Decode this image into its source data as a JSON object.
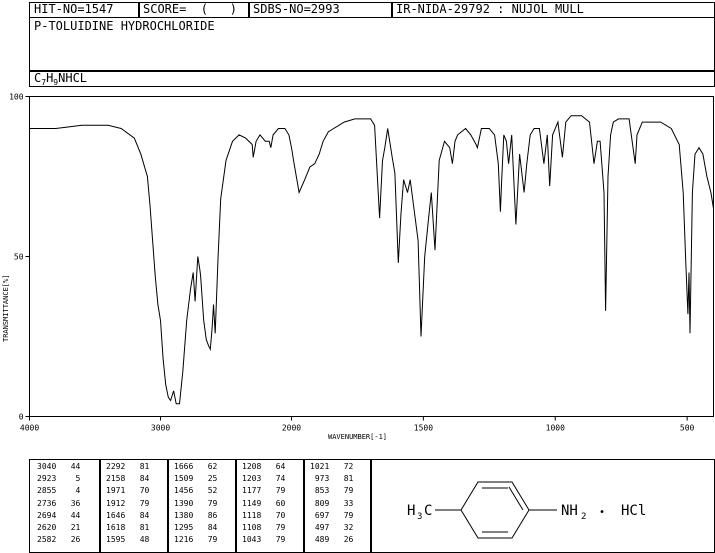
{
  "header": {
    "hit_no": "HIT-NO=1547",
    "score": "SCORE=  (   )",
    "sdbs_no": "SDBS-NO=2993",
    "ir_nida": "IR-NIDA-29792 : NUJOL MULL"
  },
  "compound": {
    "name": "P-TOLUIDINE HYDROCHLORIDE",
    "formula": {
      "c": "C",
      "c_sub": "7",
      "h": "H",
      "h_sub": "9",
      "rest": "NHCL"
    }
  },
  "structure": {
    "left_label": "H",
    "left_sub": "3",
    "left_c": "C",
    "right_label": "NH",
    "right_sub": "2",
    "dot": "•",
    "hcl": "HCl"
  },
  "chart_data": {
    "type": "line",
    "xlabel": "WAVENUMBER[-1]",
    "ylabel": "TRANSMITTANCE[%]",
    "xlim": [
      4000,
      400
    ],
    "ylim": [
      0,
      100
    ],
    "x_ticks": [
      "4000",
      "3000",
      "2000",
      "1500",
      "1000",
      "500"
    ],
    "y_ticks": [
      "100",
      "50",
      "0"
    ],
    "grid": false,
    "series": [
      {
        "points": [
          [
            4000,
            90
          ],
          [
            3800,
            90
          ],
          [
            3600,
            91
          ],
          [
            3400,
            91
          ],
          [
            3300,
            90
          ],
          [
            3200,
            87
          ],
          [
            3150,
            82
          ],
          [
            3100,
            75
          ],
          [
            3080,
            66
          ],
          [
            3060,
            55
          ],
          [
            3040,
            44
          ],
          [
            3020,
            35
          ],
          [
            3000,
            30
          ],
          [
            2980,
            18
          ],
          [
            2960,
            10
          ],
          [
            2940,
            6
          ],
          [
            2923,
            5
          ],
          [
            2900,
            8
          ],
          [
            2880,
            4
          ],
          [
            2855,
            4
          ],
          [
            2830,
            14
          ],
          [
            2800,
            30
          ],
          [
            2770,
            40
          ],
          [
            2750,
            45
          ],
          [
            2736,
            36
          ],
          [
            2715,
            50
          ],
          [
            2700,
            46
          ],
          [
            2694,
            44
          ],
          [
            2670,
            30
          ],
          [
            2650,
            24
          ],
          [
            2632,
            22
          ],
          [
            2620,
            21
          ],
          [
            2605,
            28
          ],
          [
            2595,
            35
          ],
          [
            2582,
            26
          ],
          [
            2560,
            50
          ],
          [
            2540,
            68
          ],
          [
            2500,
            80
          ],
          [
            2450,
            86
          ],
          [
            2400,
            88
          ],
          [
            2350,
            87
          ],
          [
            2300,
            85
          ],
          [
            2292,
            81
          ],
          [
            2270,
            86
          ],
          [
            2240,
            88
          ],
          [
            2200,
            86
          ],
          [
            2170,
            86
          ],
          [
            2158,
            84
          ],
          [
            2140,
            88
          ],
          [
            2100,
            90
          ],
          [
            2050,
            90
          ],
          [
            2020,
            88
          ],
          [
            2000,
            84
          ],
          [
            1990,
            79
          ],
          [
            1971,
            70
          ],
          [
            1950,
            74
          ],
          [
            1930,
            78
          ],
          [
            1912,
            79
          ],
          [
            1895,
            82
          ],
          [
            1880,
            86
          ],
          [
            1860,
            89
          ],
          [
            1840,
            90
          ],
          [
            1800,
            92
          ],
          [
            1760,
            93
          ],
          [
            1720,
            93
          ],
          [
            1700,
            93
          ],
          [
            1685,
            91
          ],
          [
            1666,
            62
          ],
          [
            1655,
            80
          ],
          [
            1646,
            84
          ],
          [
            1635,
            90
          ],
          [
            1618,
            81
          ],
          [
            1608,
            76
          ],
          [
            1595,
            48
          ],
          [
            1585,
            63
          ],
          [
            1575,
            74
          ],
          [
            1560,
            70
          ],
          [
            1550,
            74
          ],
          [
            1520,
            55
          ],
          [
            1509,
            25
          ],
          [
            1495,
            50
          ],
          [
            1480,
            62
          ],
          [
            1470,
            70
          ],
          [
            1456,
            52
          ],
          [
            1440,
            80
          ],
          [
            1420,
            86
          ],
          [
            1400,
            84
          ],
          [
            1390,
            79
          ],
          [
            1380,
            86
          ],
          [
            1370,
            88
          ],
          [
            1340,
            90
          ],
          [
            1320,
            88
          ],
          [
            1300,
            85
          ],
          [
            1295,
            84
          ],
          [
            1280,
            90
          ],
          [
            1250,
            90
          ],
          [
            1230,
            88
          ],
          [
            1216,
            79
          ],
          [
            1208,
            64
          ],
          [
            1203,
            74
          ],
          [
            1195,
            88
          ],
          [
            1185,
            86
          ],
          [
            1177,
            79
          ],
          [
            1165,
            88
          ],
          [
            1149,
            60
          ],
          [
            1135,
            82
          ],
          [
            1118,
            70
          ],
          [
            1108,
            79
          ],
          [
            1095,
            88
          ],
          [
            1080,
            90
          ],
          [
            1060,
            90
          ],
          [
            1043,
            79
          ],
          [
            1030,
            88
          ],
          [
            1021,
            72
          ],
          [
            1010,
            88
          ],
          [
            990,
            92
          ],
          [
            973,
            81
          ],
          [
            960,
            92
          ],
          [
            940,
            94
          ],
          [
            900,
            94
          ],
          [
            870,
            92
          ],
          [
            853,
            79
          ],
          [
            840,
            86
          ],
          [
            830,
            86
          ],
          [
            815,
            70
          ],
          [
            809,
            33
          ],
          [
            800,
            75
          ],
          [
            790,
            88
          ],
          [
            780,
            92
          ],
          [
            760,
            93
          ],
          [
            720,
            93
          ],
          [
            697,
            79
          ],
          [
            690,
            88
          ],
          [
            670,
            92
          ],
          [
            640,
            92
          ],
          [
            600,
            92
          ],
          [
            560,
            90
          ],
          [
            530,
            85
          ],
          [
            515,
            70
          ],
          [
            505,
            48
          ],
          [
            497,
            32
          ],
          [
            493,
            45
          ],
          [
            489,
            26
          ],
          [
            480,
            70
          ],
          [
            470,
            82
          ],
          [
            455,
            84
          ],
          [
            440,
            82
          ],
          [
            425,
            75
          ],
          [
            410,
            70
          ],
          [
            400,
            65
          ]
        ]
      }
    ],
    "peaks": [
      [
        3040,
        44
      ],
      [
        2923,
        5
      ],
      [
        2855,
        4
      ],
      [
        2736,
        36
      ],
      [
        2694,
        44
      ],
      [
        2620,
        21
      ],
      [
        2582,
        26
      ],
      [
        2292,
        81
      ],
      [
        2158,
        84
      ],
      [
        1971,
        70
      ],
      [
        1912,
        79
      ],
      [
        1646,
        84
      ],
      [
        1618,
        81
      ],
      [
        1595,
        48
      ],
      [
        1666,
        62
      ],
      [
        1509,
        25
      ],
      [
        1456,
        52
      ],
      [
        1390,
        79
      ],
      [
        1380,
        86
      ],
      [
        1295,
        84
      ],
      [
        1216,
        79
      ],
      [
        1208,
        64
      ],
      [
        1203,
        74
      ],
      [
        1177,
        79
      ],
      [
        1149,
        60
      ],
      [
        1118,
        70
      ],
      [
        1108,
        79
      ],
      [
        1043,
        79
      ],
      [
        1021,
        72
      ],
      [
        973,
        81
      ],
      [
        853,
        79
      ],
      [
        809,
        33
      ],
      [
        697,
        79
      ],
      [
        497,
        32
      ],
      [
        489,
        26
      ]
    ]
  }
}
